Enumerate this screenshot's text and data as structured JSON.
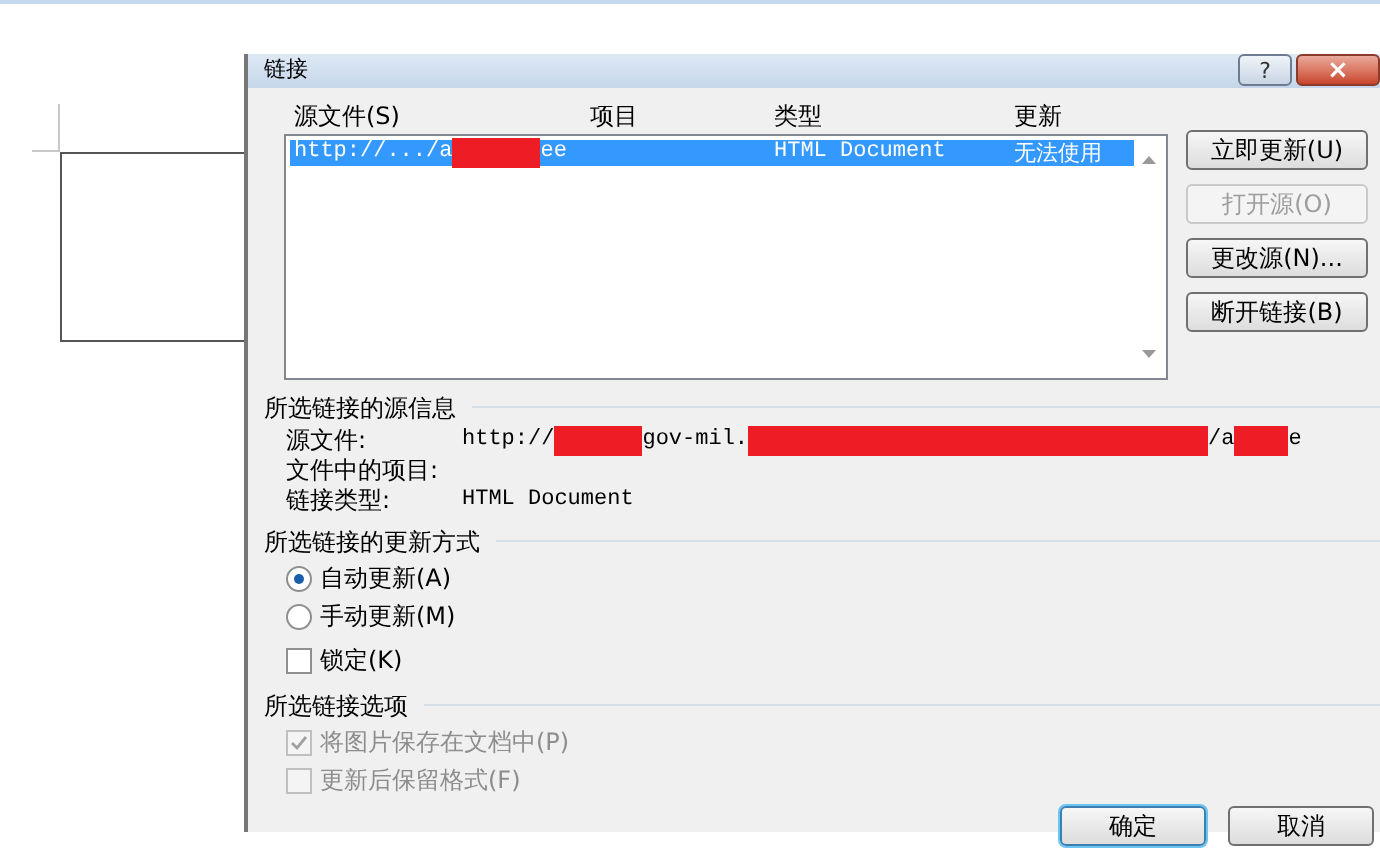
{
  "window": {
    "title": "链接",
    "help": "?",
    "close": "×"
  },
  "links_list": {
    "columns": [
      "源文件(S)",
      "项目",
      "类型",
      "更新"
    ],
    "rows": [
      {
        "selected": true,
        "source": [
          {
            "kind": "text",
            "text": "http://.../a"
          },
          {
            "kind": "redacted"
          },
          {
            "kind": "text",
            "text": "ee"
          }
        ],
        "type": "HTML Document",
        "update": "无法使用"
      }
    ]
  },
  "side_buttons": [
    {
      "label": "立即更新(U)",
      "disabled": false
    },
    {
      "label": "打开源(O)",
      "disabled": true
    },
    {
      "label": "更改源(N)...",
      "disabled": false
    },
    {
      "label": "断开链接(B)",
      "disabled": false
    }
  ],
  "source_info": {
    "heading": "所选链接的源信息",
    "fields": [
      {
        "label": "源文件:",
        "value": [
          {
            "kind": "text",
            "text": "http://"
          },
          {
            "kind": "redacted"
          },
          {
            "kind": "text",
            "text": "gov-mil."
          },
          {
            "kind": "redacted"
          },
          {
            "kind": "text",
            "text": "/a"
          },
          {
            "kind": "redacted"
          },
          {
            "kind": "text",
            "text": "e"
          }
        ]
      },
      {
        "label": "文件中的项目:"
      },
      {
        "label": "链接类型:",
        "value": [
          {
            "kind": "text",
            "text": "HTML Document"
          }
        ]
      }
    ]
  },
  "update_mode": {
    "heading": "所选链接的更新方式",
    "options": [
      {
        "label": "自动更新(A)",
        "selected": true
      },
      {
        "label": "手动更新(M)",
        "selected": false
      }
    ],
    "lock": {
      "label": "锁定(K)",
      "checked": false
    }
  },
  "link_options": {
    "heading": "所选链接选项",
    "checks": [
      {
        "label": "将图片保存在文档中(P)",
        "checked": true,
        "disabled": true
      },
      {
        "label": "更新后保留格式(F)",
        "checked": false,
        "disabled": true
      }
    ]
  },
  "footer_buttons": [
    {
      "label": "确定",
      "default": true
    },
    {
      "label": "取消",
      "default": false
    }
  ]
}
